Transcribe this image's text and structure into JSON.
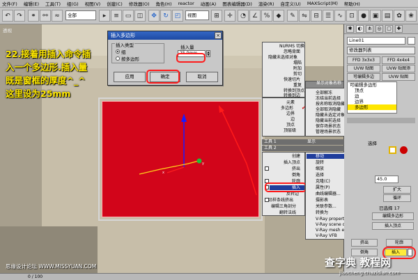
{
  "menubar": [
    "文件(F)",
    "编辑(E)",
    "工具(T)",
    "组(G)",
    "视图(V)",
    "创建(C)",
    "修改器(O)",
    "角色(H)",
    "reactor",
    "动画(A)",
    "图表编辑器(D)",
    "渲染(R)",
    "自定义(U)",
    "MAXScript(M)",
    "帮助(H)"
  ],
  "toolbar": {
    "selection_filter": "全部",
    "coord_system": "视图"
  },
  "viewport": {
    "label": "透视"
  },
  "annotation": "22.接着用插入命令插入一个多边形.插入量既是窗框的厚度^_^ 这里设为25mm",
  "dialog": {
    "title": "插入多边形",
    "close": "×",
    "insert_type_label": "插入类型",
    "option_group": "组",
    "option_polygon": "按多边形",
    "amount_label": "插入量",
    "amount_value": "25.0mm",
    "apply": "应用",
    "ok": "确定",
    "cancel": "取消"
  },
  "quad_menu_top": [
    "NURMS 切换",
    "忽略背面",
    "隐藏未选择对象",
    "塌陷",
    "附加",
    "剪切",
    "快速切片",
    "重复",
    "转换到顶点",
    "转换到边"
  ],
  "quad_menu_mid_left": [
    "元素",
    "多边形",
    "边界",
    "边",
    "顶点",
    "顶层级"
  ],
  "quad_menu_mid_right": [
    "全部解冻",
    "冻结当前选择",
    "按名称取消隐藏",
    "全部取消隐藏",
    "隐藏未选定对象",
    "隐藏当前选择",
    "保存场景状态",
    "管理场景状态"
  ],
  "tools_menu": {
    "header1": "工具 1",
    "header2": "工具 2",
    "header_right": "显示",
    "header_right2": "变换",
    "left": [
      "创建",
      "插入顶点",
      "挤出",
      "倒角",
      "轮廓",
      "插入",
      "反转边",
      "沿样条线挤出",
      "编辑三角剖分",
      "翻转法线"
    ],
    "right": [
      "移动",
      "旋转",
      "缩放",
      "选择",
      "克隆(C)",
      "属性(P)",
      "曲线编辑器...",
      "摄影表",
      "关联参数...",
      "转换为",
      "V-Ray properties",
      "V-Ray scene converter",
      "V-Ray mesh export",
      "V-Ray VFB"
    ],
    "right_submenu": "显示对象名称"
  },
  "panel": {
    "object_name": "Line01",
    "modifier_list": "修改器列表",
    "btn_ffd3": "FFD 3x3x3",
    "btn_ffd4": "FFD 4x4x4",
    "btn_uvw_map": "UVW 贴图",
    "btn_uvw_map2": "UVW 贴图添",
    "btn_uvw_xform": "UVW 贴图",
    "btn_edit_poly": "可编辑多边",
    "stack": [
      "可编辑多边形",
      "顶点",
      "边",
      "边界",
      "多边形"
    ],
    "selection_label": "选择",
    "spinner_value": "45.0",
    "expand": "扩大",
    "loop": "循环",
    "selected_count": "已选择 17",
    "edit_polygon": "编辑多边形",
    "insert_vertex": "插入顶点",
    "extrude": "挤出",
    "outline": "轮廓",
    "bevel": "倒角",
    "insert": "插入"
  },
  "statusbar": {
    "frame": "0 / 100"
  },
  "watermarks": {
    "left": "思缘设计论坛 WWW.MISSYUAN.COM",
    "brand": "查字典 教程网",
    "url": "jiaocheng.chazidian.com"
  }
}
